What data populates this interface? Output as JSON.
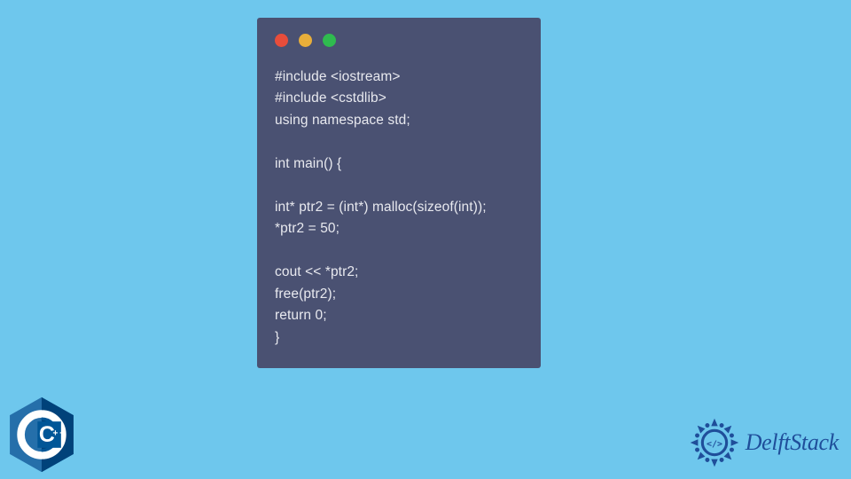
{
  "code": {
    "lines": [
      "#include <iostream>",
      "#include <cstdlib>",
      "using namespace std;",
      "",
      "int main() {",
      "",
      "int* ptr2 = (int*) malloc(sizeof(int));",
      "*ptr2 = 50;",
      "",
      "cout << *ptr2;",
      "free(ptr2);",
      "return 0;",
      "}"
    ]
  },
  "colors": {
    "background": "#6ec7ed",
    "window": "#4a5172",
    "code_text": "#e8e9ef",
    "dot_red": "#e84d3b",
    "dot_yellow": "#e8ae3a",
    "dot_green": "#2fbb4f",
    "cpp_blue": "#005697",
    "cpp_light": "#6a9fcf",
    "delft_blue": "#1f4e9a"
  },
  "branding": {
    "delftstack_label": "DelftStack",
    "cpp_label": "C++"
  }
}
